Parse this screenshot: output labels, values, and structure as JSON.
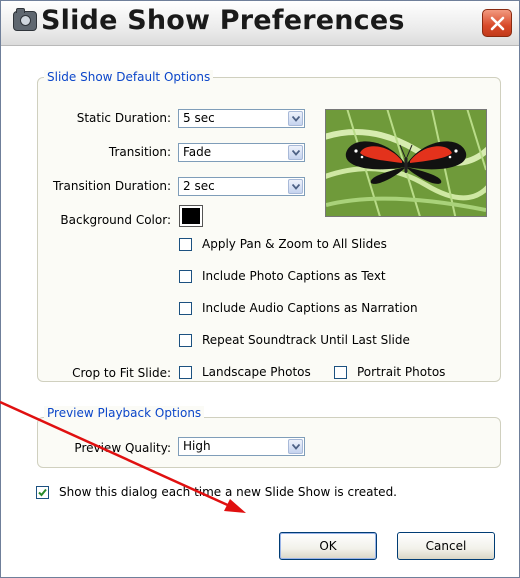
{
  "window": {
    "title": "Slide Show Preferences",
    "app_icon": "camera-icon",
    "close_icon": "close-icon"
  },
  "default_options": {
    "legend": "Slide Show Default Options",
    "static_duration": {
      "label": "Static Duration:",
      "value": "5 sec"
    },
    "transition": {
      "label": "Transition:",
      "value": "Fade"
    },
    "transition_duration": {
      "label": "Transition Duration:",
      "value": "2 sec"
    },
    "background_color": {
      "label": "Background Color:",
      "value": "#000000"
    },
    "checkboxes": [
      {
        "label": "Apply Pan & Zoom to All Slides",
        "checked": false
      },
      {
        "label": "Include Photo Captions as Text",
        "checked": false
      },
      {
        "label": "Include Audio Captions as Narration",
        "checked": false
      },
      {
        "label": "Repeat Soundtrack Until Last Slide",
        "checked": false
      }
    ],
    "crop": {
      "label": "Crop to Fit Slide:",
      "landscape": {
        "label": "Landscape Photos",
        "checked": false
      },
      "portrait": {
        "label": "Portrait Photos",
        "checked": false
      }
    },
    "preview_image": "butterfly-photo"
  },
  "preview_options": {
    "legend": "Preview Playback Options",
    "quality": {
      "label": "Preview Quality:",
      "value": "High"
    }
  },
  "show_dialog": {
    "label": "Show this dialog each time a new Slide Show is created.",
    "checked": true
  },
  "buttons": {
    "ok": "OK",
    "cancel": "Cancel"
  },
  "colors": {
    "legend_blue": "#0b46c9",
    "annotation_arrow": "#e01010",
    "check_green": "#2a8a2a"
  }
}
